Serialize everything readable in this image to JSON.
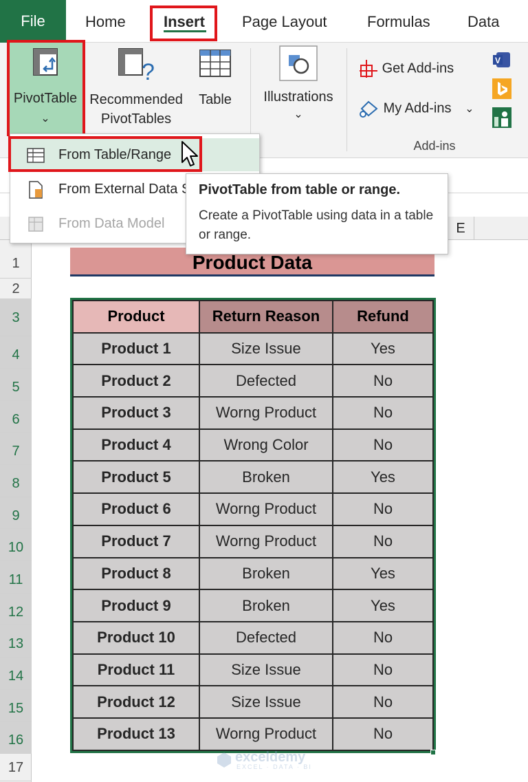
{
  "ribbon": {
    "tabs": [
      "File",
      "Home",
      "Insert",
      "Page Layout",
      "Formulas",
      "Data"
    ],
    "active_tab": "Insert",
    "pivottable_label": "PivotTable",
    "recommended_line1": "Recommended",
    "recommended_line2": "PivotTables",
    "table_label": "Table",
    "illustrations_label": "Illustrations",
    "get_addins_label": "Get Add-ins",
    "my_addins_label": "My Add-ins",
    "addins_group_label": "Add-ins",
    "accent_color": "#217346",
    "highlight_color": "#e0161b"
  },
  "menu": {
    "items": [
      "From Table/Range",
      "From External Data Source",
      "From Data Model"
    ],
    "disabled_item": "From Data Model"
  },
  "tooltip": {
    "title": "PivotTable from table or range.",
    "body": "Create a PivotTable using data in a table or range."
  },
  "sheet": {
    "visible_column": "E",
    "row_numbers": [
      "1",
      "2",
      "3",
      "4",
      "5",
      "6",
      "7",
      "8",
      "9",
      "10",
      "11",
      "12",
      "13",
      "14",
      "15",
      "16",
      "17"
    ],
    "title": "Product Data",
    "headers": [
      "Product",
      "Return Reason",
      "Refund"
    ],
    "rows": [
      [
        "Product 1",
        "Size Issue",
        "Yes"
      ],
      [
        "Product 2",
        "Defected",
        "No"
      ],
      [
        "Product 3",
        "Worng Product",
        "No"
      ],
      [
        "Product 4",
        "Wrong Color",
        "No"
      ],
      [
        "Product 5",
        "Broken",
        "Yes"
      ],
      [
        "Product 6",
        "Worng Product",
        "No"
      ],
      [
        "Product 7",
        "Worng Product",
        "No"
      ],
      [
        "Product 8",
        "Broken",
        "Yes"
      ],
      [
        "Product 9",
        "Broken",
        "Yes"
      ],
      [
        "Product 10",
        "Defected",
        "No"
      ],
      [
        "Product 11",
        "Size Issue",
        "No"
      ],
      [
        "Product 12",
        "Size Issue",
        "No"
      ],
      [
        "Product 13",
        "Worng Product",
        "No"
      ]
    ]
  },
  "watermark": {
    "name": "exceldemy",
    "tagline": "EXCEL · DATA · BI"
  }
}
